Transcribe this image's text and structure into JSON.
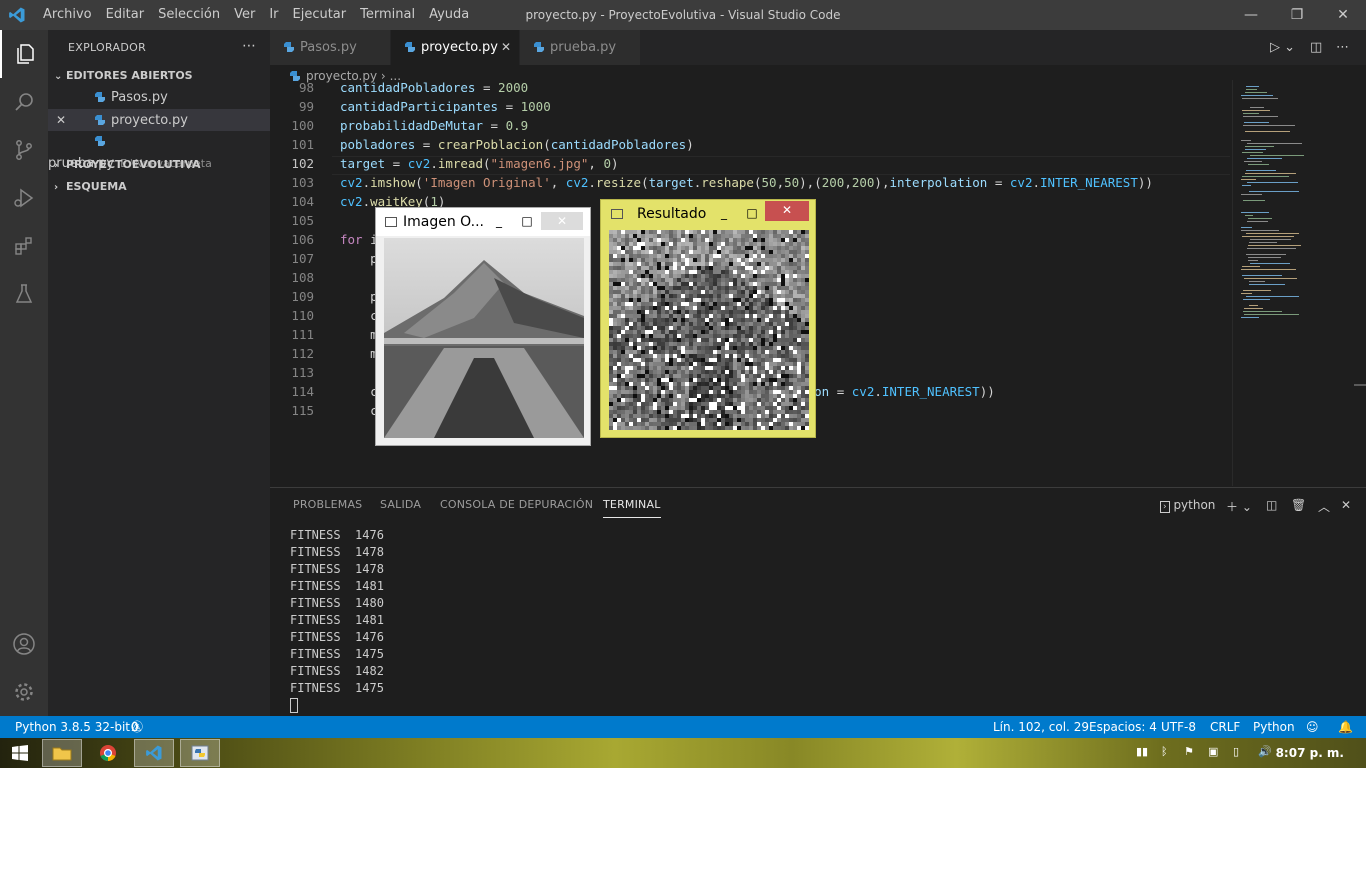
{
  "window": {
    "title": "proyecto.py - ProyectoEvolutiva - Visual Studio Code",
    "menu": [
      "Archivo",
      "Editar",
      "Selección",
      "Ver",
      "Ir",
      "Ejecutar",
      "Terminal",
      "Ayuda"
    ]
  },
  "sidebar": {
    "header": "EXPLORADOR",
    "open_editors": "EDITORES ABIERTOS",
    "files": [
      {
        "name": "Pasos.py",
        "path": ""
      },
      {
        "name": "proyecto.py",
        "path": ""
      },
      {
        "name": "prueba.py",
        "path": "E:\\Nuevacarpeta"
      }
    ],
    "project": "PROYECTOEVOLUTIVA",
    "outline": "ESQUEMA"
  },
  "tabs": [
    "Pasos.py",
    "proyecto.py",
    "prueba.py"
  ],
  "breadcrumb": {
    "file": "proyecto.py",
    "rest": "..."
  },
  "editor": {
    "line_numbers": [
      "98",
      "99",
      "100",
      "101",
      "102",
      "103",
      "104",
      "105",
      "106",
      "107",
      "108",
      "109",
      "110",
      "111",
      "112",
      "113",
      "114",
      "115"
    ],
    "lines": [
      "cantidadPobladores = 2000",
      "cantidadParticipantes = 1000",
      "probabilidadDeMutar = 0.9",
      "pobladores = crearPoblacion(cantidadPobladores)",
      "target = cv2.imread(\"imagen6.jpg\", 0)",
      "cv2.imshow('Imagen Original', cv2.resize(target.reshape(50,50),(200,200),interpolation = cv2.INTER_NEAREST))",
      "cv2.waitKey(1)",
      "",
      "for i",
      "    p",
      "",
      "    p                      r(",
      "    c                      ce                      cipantes)",
      "    m                      po",
      "    m                      to",
      "",
      "    c                      .r                      ,interpolation = cv2.INTER_NEAREST))",
      "    c"
    ]
  },
  "panel": {
    "tabs": [
      "PROBLEMAS",
      "SALIDA",
      "CONSOLA DE DEPURACIÓN",
      "TERMINAL"
    ],
    "terminal_name": "python",
    "output": [
      "FITNESS  1476",
      "FITNESS  1478",
      "FITNESS  1478",
      "FITNESS  1481",
      "FITNESS  1480",
      "FITNESS  1481",
      "FITNESS  1476",
      "FITNESS  1475",
      "FITNESS  1482",
      "FITNESS  1475"
    ]
  },
  "status": {
    "python": "Python 3.8.5 32-bit",
    "errors": "0",
    "warnings": "0",
    "position": "Lín. 102, col. 29",
    "spaces": "Espacios: 4",
    "encoding": "UTF-8",
    "eol": "CRLF",
    "language": "Python"
  },
  "cv_windows": {
    "original_title": "Imagen O...",
    "result_title": "Resultado"
  },
  "taskbar": {
    "clock": "8:07 p. m."
  },
  "colors": {
    "accent": "#007acc",
    "result_frame": "#e3e26a",
    "taskbar": "#8a8a24"
  }
}
